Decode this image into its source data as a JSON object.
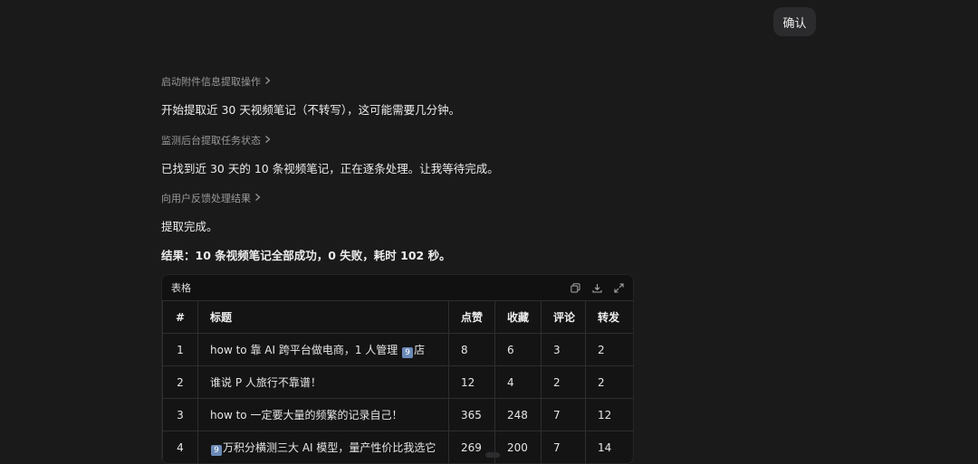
{
  "header": {
    "confirm_label": "确认"
  },
  "steps": [
    {
      "label": "启动附件信息提取操作",
      "message": "开始提取近 30 天视频笔记（不转写），这可能需要几分钟。"
    },
    {
      "label": "监测后台提取任务状态",
      "message": "已找到近 30 天的 10 条视频笔记，正在逐条处理。让我等待完成。"
    },
    {
      "label": "向用户反馈处理结果",
      "message": "提取完成。"
    }
  ],
  "result_summary": "结果：10 条视频笔记全部成功，0 失败，耗时 102 秒。",
  "table": {
    "title": "表格",
    "columns": [
      "#",
      "标题",
      "点赞",
      "收藏",
      "评论",
      "转发"
    ],
    "rows": [
      {
        "index": "1",
        "title_pre": "how to 靠 AI 跨平台做电商，1 人管理 ",
        "title_badge": "9",
        "title_post": "店",
        "likes": "8",
        "favorites": "6",
        "comments": "3",
        "shares": "2"
      },
      {
        "index": "2",
        "title_pre": "谁说 P 人旅行不靠谱！",
        "title_badge": "",
        "title_post": "",
        "likes": "12",
        "favorites": "4",
        "comments": "2",
        "shares": "2"
      },
      {
        "index": "3",
        "title_pre": "how to 一定要大量的频繁的记录自己！",
        "title_badge": "",
        "title_post": "",
        "likes": "365",
        "favorites": "248",
        "comments": "7",
        "shares": "12"
      },
      {
        "index": "4",
        "title_pre": "",
        "title_badge": "9",
        "title_post": "万积分横测三大 AI 模型，量产性价比我选它",
        "likes": "269",
        "favorites": "200",
        "comments": "7",
        "shares": "14"
      }
    ]
  },
  "icons": {
    "copy": "copy-icon",
    "download": "download-icon",
    "expand": "expand-icon",
    "chevron": "chevron-right-icon"
  }
}
